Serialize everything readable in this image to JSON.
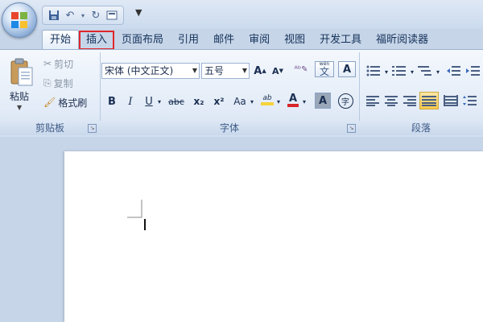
{
  "qat": {
    "more_label": "▼"
  },
  "tabs": [
    {
      "label": "开始"
    },
    {
      "label": "插入"
    },
    {
      "label": "页面布局"
    },
    {
      "label": "引用"
    },
    {
      "label": "邮件"
    },
    {
      "label": "审阅"
    },
    {
      "label": "视图"
    },
    {
      "label": "开发工具"
    },
    {
      "label": "福昕阅读器"
    }
  ],
  "clipboard": {
    "paste_label": "粘贴",
    "cut_label": "剪切",
    "copy_label": "复制",
    "format_painter_label": "格式刷",
    "group_label": "剪贴板"
  },
  "font": {
    "font_name": "宋体 (中文正文)",
    "font_size": "五号",
    "group_label": "字体",
    "bold": "B",
    "italic": "I",
    "underline": "U",
    "strike": "abc",
    "subscript": "x₂",
    "superscript": "x²",
    "change_case": "Aa",
    "highlight": "ab",
    "font_color": "A",
    "grow": "A",
    "shrink": "A",
    "phonetic": "wén",
    "char_border": "A",
    "enclose": "字",
    "char_shading": "A"
  },
  "paragraph": {
    "group_label": "段落"
  },
  "colors": {
    "accent_red": "#e0262b",
    "highlight_yellow": "#f5d33a",
    "font_color_red": "#d8262b"
  }
}
